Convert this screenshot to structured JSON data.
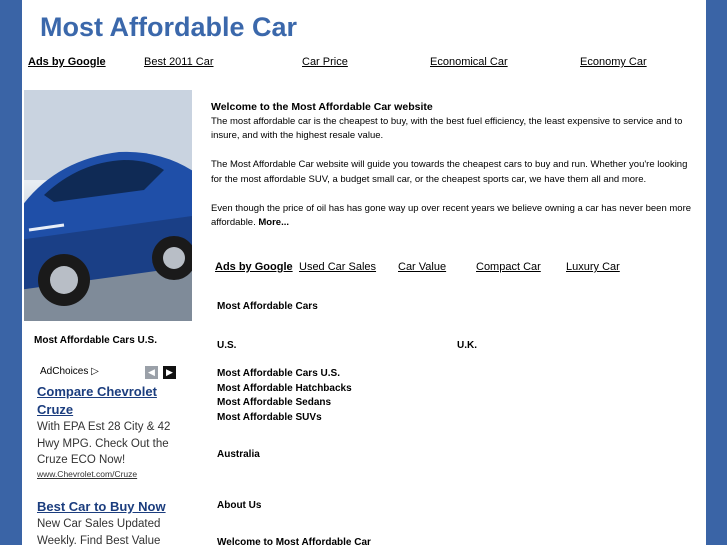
{
  "site": {
    "title": "Most Affordable Car"
  },
  "topnav": {
    "ads_label": "Ads by Google",
    "links": [
      "Best 2011 Car",
      "Car Price",
      "Economical Car",
      "Economy Car"
    ]
  },
  "sidebar": {
    "heading": "Most Affordable Cars U.S.",
    "adchoices": "AdChoices",
    "ads": [
      {
        "title": "Compare Chevrolet Cruze",
        "text": "With EPA Est 28 City & 42 Hwy MPG. Check Out the Cruze ECO Now!",
        "url": "www.Chevrolet.com/Cruze"
      },
      {
        "title": "Best Car to Buy Now",
        "text": "New Car Sales Updated Weekly. Find Best Value"
      }
    ]
  },
  "main": {
    "welcome_title": "Welcome to the Most Affordable Car website",
    "p1": "The most affordable car is the cheapest to buy, with the best fuel efficiency, the least expensive to service and to insure, and with the highest resale value.",
    "p2": "The Most Affordable Car website will guide you towards the cheapest cars to buy and run. Whether you're looking for the most affordable SUV, a budget small car, or the cheapest sports car, we have them all and more.",
    "p3": "Even though the price of oil has has gone way up over recent years we believe owning a car has never been more affordable.",
    "more": "More..."
  },
  "subnav": {
    "ads_label": "Ads by Google",
    "links": [
      "Used Car Sales",
      "Car Value",
      "Compact Car",
      "Luxury Car"
    ]
  },
  "sections": {
    "heading": "Most Affordable Cars",
    "us": "U.S.",
    "uk": "U.K.",
    "us_links": [
      "Most Affordable Cars U.S.",
      "Most Affordable Hatchbacks",
      "Most Affordable Sedans",
      "Most Affordable SUVs"
    ],
    "australia": "Australia",
    "about": "About Us",
    "welcome_link": "Welcome to Most Affordable Car"
  },
  "colors": {
    "frame": "#3a64a6",
    "title": "#3b68ab",
    "car": "#1f4fa8"
  },
  "icons": {
    "adchoices": "adchoices-icon",
    "prev": "arrow-left-icon",
    "next": "arrow-right-icon"
  }
}
